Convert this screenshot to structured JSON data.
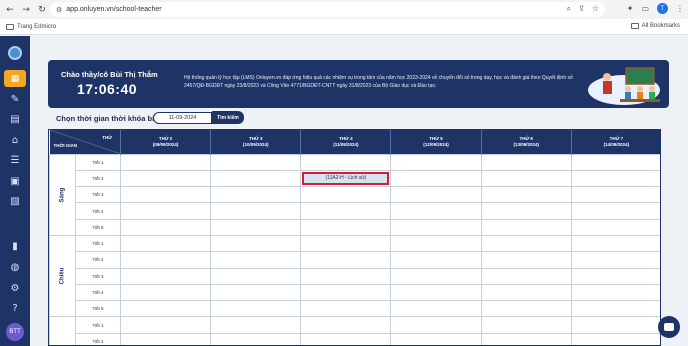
{
  "browser": {
    "url": "app.onluyen.vn/school-teacher",
    "bookmark_home": "Trang Edmicro",
    "bookmark_all": "All Bookmarks",
    "profile_initial": "T"
  },
  "sidebar": {
    "avatar_initials": "BTT"
  },
  "banner": {
    "greeting": "Chào thầy/cô Bùi Thị Thắm",
    "clock": "17:06:40",
    "notice": "Hệ thống quản lý học tập (LMS) Onluyen.vn đáp ứng hiệu quả các nhiệm vụ trong tâm của năm học 2023-2024 về chuyển đổi số trong dạy, học và đánh giá theo Quyết định số 2457/QĐ-BGDĐT ngày 23/8/2023 và Công Văn 4771/BGDĐT-CNTT ngày 31/8/2023 của Bộ Giáo dục và Đào tạo."
  },
  "picker": {
    "label": "Chọn thời gian thời khóa biểu:",
    "date_value": "11-09-2024",
    "search_label": "Tìm kiếm"
  },
  "table": {
    "corner_day": "THỨ",
    "corner_time": "THỜI GIAN",
    "days": [
      {
        "name": "THỨ 2",
        "date": "(09/09/2024)"
      },
      {
        "name": "THỨ 3",
        "date": "(10/09/2024)"
      },
      {
        "name": "THỨ 4",
        "date": "(11/09/2024)"
      },
      {
        "name": "THỨ 5",
        "date": "(12/09/2024)"
      },
      {
        "name": "THỨ 6",
        "date": "(13/09/2024)"
      },
      {
        "name": "THỨ 7",
        "date": "(14/09/2024)"
      }
    ],
    "sessions": [
      {
        "name": "Sáng",
        "periods": [
          "Tiết 1",
          "Tiết 2",
          "Tiết 3",
          "Tiết 4",
          "Tiết 5"
        ]
      },
      {
        "name": "Chiều",
        "periods": [
          "Tiết 1",
          "Tiết 2",
          "Tiết 3",
          "Tiết 4",
          "Tiết 5"
        ]
      },
      {
        "name": "",
        "periods": [
          "Tiết 1",
          "Tiết 2"
        ]
      }
    ],
    "lesson": {
      "session": 0,
      "period": 1,
      "day": 2,
      "text": "(11A2-H - Lịch sử)"
    }
  }
}
